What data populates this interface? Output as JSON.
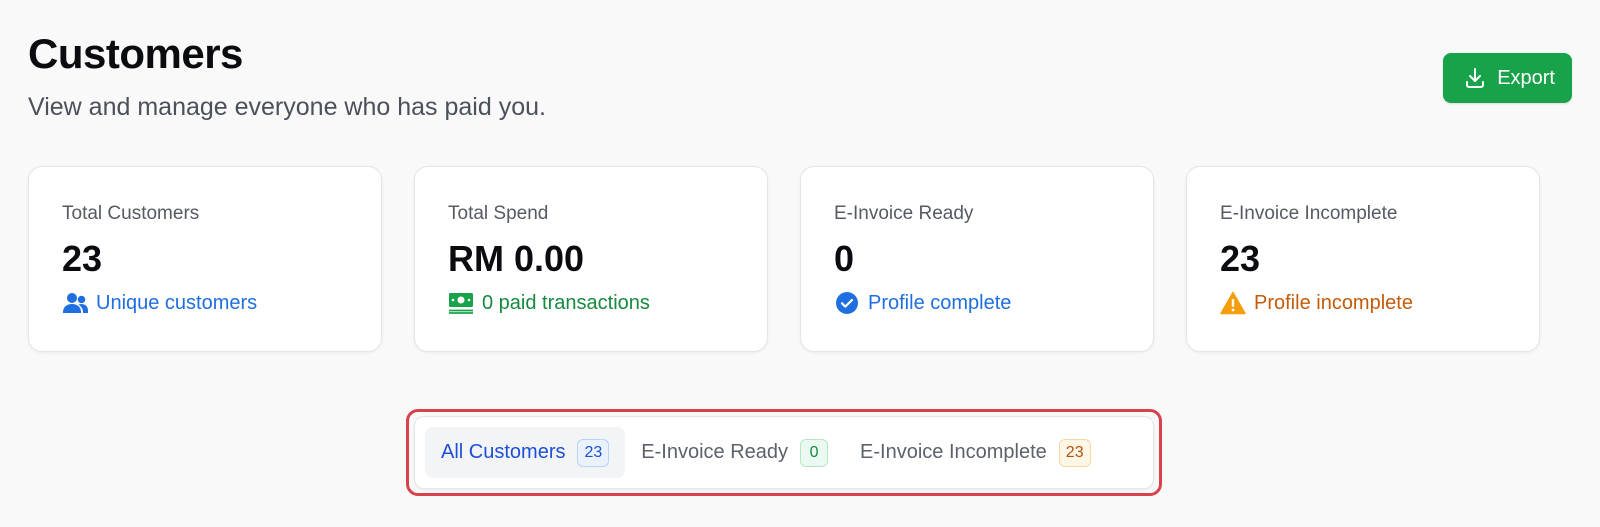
{
  "header": {
    "title": "Customers",
    "subtitle": "View and manage everyone who has paid you."
  },
  "toolbar": {
    "export_label": "Export"
  },
  "cards": [
    {
      "label": "Total Customers",
      "value": "23",
      "footer": "Unique customers",
      "icon": "users-icon",
      "color": "#1f6fe0"
    },
    {
      "label": "Total Spend",
      "value": "RM 0.00",
      "footer": "0 paid transactions",
      "icon": "money-icon",
      "color": "#158a3e"
    },
    {
      "label": "E-Invoice Ready",
      "value": "0",
      "footer": "Profile complete",
      "icon": "check-circle-icon",
      "color": "#1f6fe0"
    },
    {
      "label": "E-Invoice Incomplete",
      "value": "23",
      "footer": "Profile incomplete",
      "icon": "warning-icon",
      "color": "#c45a0a"
    }
  ],
  "tabs": [
    {
      "label": "All Customers",
      "count": "23",
      "active": true
    },
    {
      "label": "E-Invoice Ready",
      "count": "0",
      "active": false
    },
    {
      "label": "E-Invoice Incomplete",
      "count": "23",
      "active": false
    }
  ],
  "colors": {
    "accent": "#18a34a",
    "highlight": "#d8434b",
    "active_tab": "#1d4fd8"
  }
}
